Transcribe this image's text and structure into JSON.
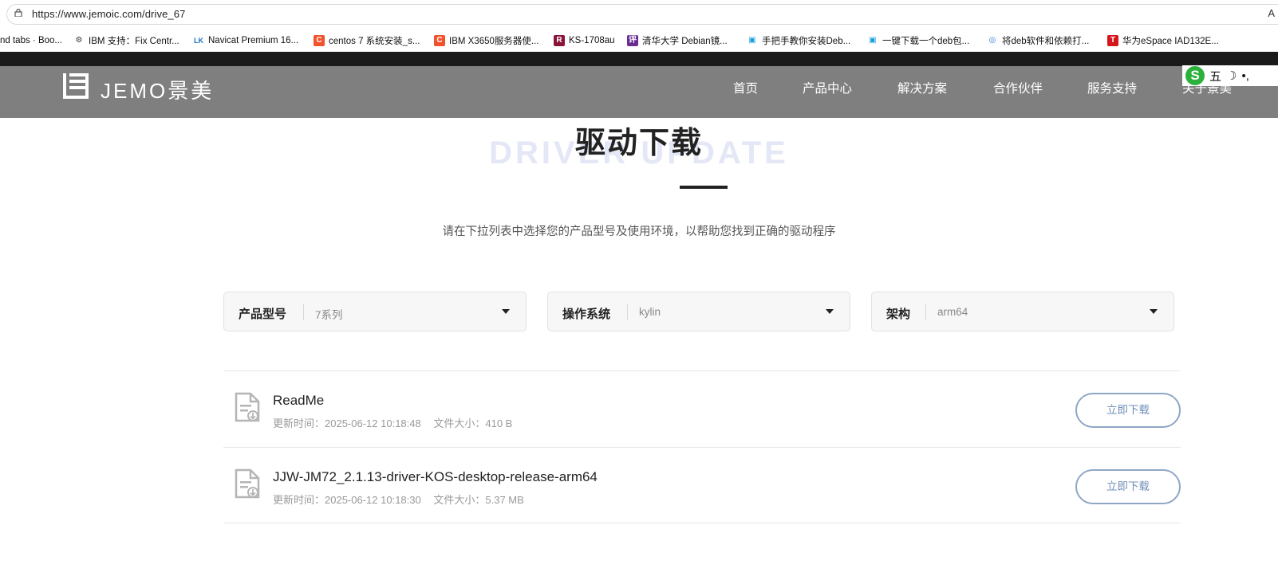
{
  "browser": {
    "url": "https://www.jemoic.com/drive_67",
    "reader_label": "A",
    "bookmarks": [
      {
        "label": "nd tabs · Boo...",
        "icon": "none",
        "color": "#ffffff"
      },
      {
        "label": "IBM 支持：Fix Centr...",
        "icon": "ibm-icon",
        "color": "#333333"
      },
      {
        "label": "Navicat Premium 16...",
        "icon": "navicat-icon",
        "color": "#1a73c9"
      },
      {
        "label": "centos 7 系统安装_s...",
        "icon": "csdn-icon",
        "color": "#f0532d"
      },
      {
        "label": "IBM X3650服务器使...",
        "icon": "csdn-icon",
        "color": "#f0532d"
      },
      {
        "label": "KS-1708au",
        "icon": "ks-icon",
        "color": "#8b1538"
      },
      {
        "label": "清华大学 Debian镜...",
        "icon": "tsinghua-icon",
        "color": "#6a2c91"
      },
      {
        "label": "手把手教你安装Deb...",
        "icon": "bilibili-icon",
        "color": "#1aa0dc"
      },
      {
        "label": "一键下载一个deb包...",
        "icon": "bilibili-icon",
        "color": "#1aa0dc"
      },
      {
        "label": "将deb软件和依赖打...",
        "icon": "blog-icon",
        "color": "#2b7bd6"
      },
      {
        "label": "华为eSpace IAD132E...",
        "icon": "toutiao-icon",
        "color": "#d4151b"
      }
    ],
    "bookmark_glyphs": [
      "",
      "⚙",
      "LK",
      "C",
      "C",
      "R",
      "评",
      "▣",
      "▣",
      "◎",
      "T"
    ]
  },
  "site": {
    "logo_text": "JEMO景美",
    "nav": [
      "首页",
      "产品中心",
      "解决方案",
      "合作伙伴",
      "服务支持",
      "关于景美"
    ],
    "ime": {
      "logo": "S",
      "mode": "五",
      "moon": "☽",
      "punct": "•,"
    }
  },
  "page": {
    "title": "驱动下载",
    "title_bg": "DRIVER UPDATE",
    "subtitle": "请在下拉列表中选择您的产品型号及使用环境，以帮助您找到正确的驱动程序"
  },
  "filters": [
    {
      "label": "产品型号",
      "value": "7系列"
    },
    {
      "label": "操作系统",
      "value": "kylin"
    },
    {
      "label": "架构",
      "value": "arm64"
    }
  ],
  "files": [
    {
      "name": "ReadMe",
      "updated_label": "更新时间：",
      "updated": "2025-06-12 10:18:48",
      "size_label": "文件大小：",
      "size": "410 B",
      "button": "立即下载"
    },
    {
      "name": "JJW-JM72_2.1.13-driver-KOS-desktop-release-arm64",
      "updated_label": "更新时间：",
      "updated": "2025-06-12 10:18:30",
      "size_label": "文件大小：",
      "size": "5.37 MB",
      "button": "立即下载"
    }
  ],
  "colors": {
    "header_bg": "#7f7f7f",
    "button_border": "#8fa7c4",
    "button_text": "#6f8fb8"
  }
}
